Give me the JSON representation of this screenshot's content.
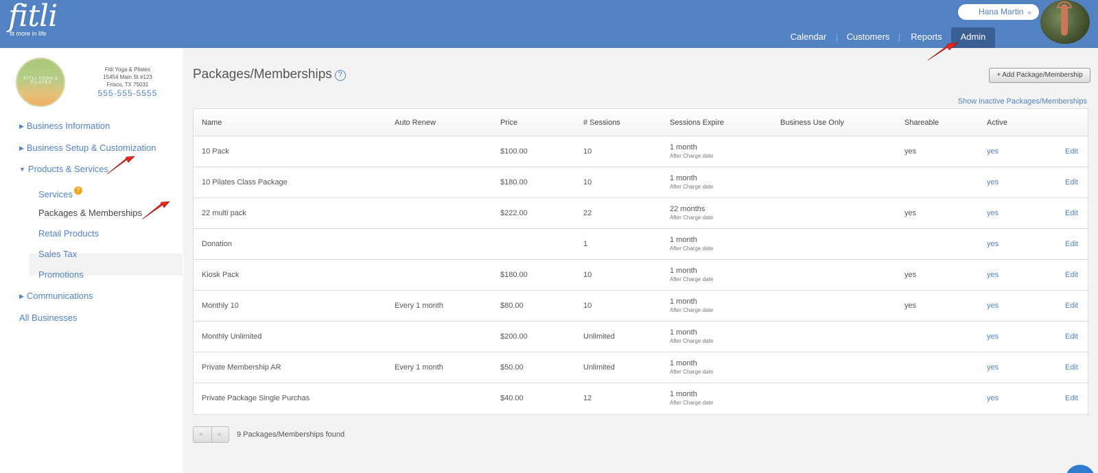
{
  "header": {
    "logo_text": "fitli",
    "logo_tagline": "fit more in life",
    "user_name": "Hana Martin",
    "nav": [
      {
        "label": "Calendar"
      },
      {
        "label": "Customers"
      },
      {
        "label": "Reports"
      },
      {
        "label": "Admin",
        "active": true
      }
    ]
  },
  "business": {
    "logo_text": "FITLI YOGA & PILATES",
    "name": "Fitli Yoga & Pilates",
    "address_line1": "15454 Main St #123",
    "address_line2": "Frisco, TX 75031",
    "phone": "555-555-5555"
  },
  "sidebar": {
    "sections": [
      {
        "label": "Business Information",
        "expanded": false
      },
      {
        "label": "Business Setup & Customization",
        "expanded": false
      },
      {
        "label": "Products & Services",
        "expanded": true
      },
      {
        "label": "Communications",
        "expanded": false
      }
    ],
    "sub_items": [
      {
        "label": "Services",
        "badge": "?"
      },
      {
        "label": "Packages & Memberships",
        "active": true
      },
      {
        "label": "Retail Products"
      },
      {
        "label": "Sales Tax"
      },
      {
        "label": "Promotions"
      }
    ],
    "all_businesses": "All Businesses"
  },
  "main": {
    "title": "Packages/Memberships",
    "help_icon": "question-circle-icon",
    "add_button": "+ Add Package/Membership",
    "show_inactive": "Show inactive Packages/Memberships",
    "columns": [
      "Name",
      "Auto Renew",
      "Price",
      "# Sessions",
      "Sessions Expire",
      "Business Use Only",
      "Shareable",
      "Active"
    ],
    "rows": [
      {
        "name": "10 Pack",
        "auto_renew": "",
        "price": "$100.00",
        "sessions": "10",
        "expire": "1 month",
        "expire_sub": "After Charge date",
        "business_only": "",
        "shareable": "yes",
        "active": "yes",
        "edit": "Edit"
      },
      {
        "name": "10 Pilates Class Package",
        "auto_renew": "",
        "price": "$180.00",
        "sessions": "10",
        "expire": "1 month",
        "expire_sub": "After Charge date",
        "business_only": "",
        "shareable": "",
        "active": "yes",
        "edit": "Edit"
      },
      {
        "name": "22 multi pack",
        "auto_renew": "",
        "price": "$222.00",
        "sessions": "22",
        "expire": "22 months",
        "expire_sub": "After Charge date",
        "business_only": "",
        "shareable": "yes",
        "active": "yes",
        "edit": "Edit"
      },
      {
        "name": "Donation",
        "auto_renew": "",
        "price": "",
        "sessions": "1",
        "expire": "1 month",
        "expire_sub": "After Charge date",
        "business_only": "",
        "shareable": "",
        "active": "yes",
        "edit": "Edit"
      },
      {
        "name": "Kiosk Pack",
        "auto_renew": "",
        "price": "$180.00",
        "sessions": "10",
        "expire": "1 month",
        "expire_sub": "After Charge date",
        "business_only": "",
        "shareable": "yes",
        "active": "yes",
        "edit": "Edit"
      },
      {
        "name": "Monthly 10",
        "auto_renew": "Every 1 month",
        "price": "$80.00",
        "sessions": "10",
        "expire": "1 month",
        "expire_sub": "After Charge date",
        "business_only": "",
        "shareable": "yes",
        "active": "yes",
        "edit": "Edit"
      },
      {
        "name": "Monthly Unlimited",
        "auto_renew": "",
        "price": "$200.00",
        "sessions": "Unlimited",
        "expire": "1 month",
        "expire_sub": "After Charge date",
        "business_only": "",
        "shareable": "",
        "active": "yes",
        "edit": "Edit"
      },
      {
        "name": "Private Membership AR",
        "auto_renew": "Every 1 month",
        "price": "$50.00",
        "sessions": "Unlimited",
        "expire": "1 month",
        "expire_sub": "After Charge date",
        "business_only": "",
        "shareable": "",
        "active": "yes",
        "edit": "Edit"
      },
      {
        "name": "Private Package Single Purchas",
        "auto_renew": "",
        "price": "$40.00",
        "sessions": "12",
        "expire": "1 month",
        "expire_sub": "After Charge date",
        "business_only": "",
        "shareable": "",
        "active": "yes",
        "edit": "Edit"
      }
    ],
    "pager": {
      "prev": "«",
      "next": "»"
    },
    "found_text": "9 Packages/Memberships found"
  },
  "colors": {
    "header_bg": "#5382c2",
    "admin_tab_bg": "#3a5f93",
    "link": "#5382c2",
    "annotation_arrow": "#e8261e"
  }
}
